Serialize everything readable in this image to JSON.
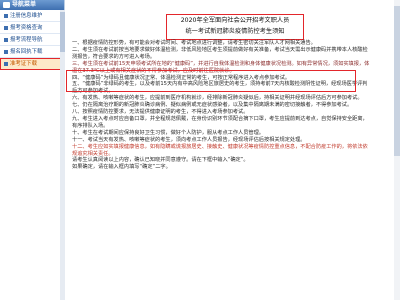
{
  "sidebar": {
    "title": "导航菜单",
    "items": [
      {
        "label": "注册信息维护"
      },
      {
        "label": "报考资格查询"
      },
      {
        "label": "报考流程导航"
      },
      {
        "label": "报名回执下载"
      },
      {
        "label": "准考证下载"
      }
    ]
  },
  "doc": {
    "title_line1": "2020年全军面向社会公开招考文职人员",
    "title_line2": "统一考试新冠肺炎疫情防控考生须知",
    "paragraphs": [
      "一、根据疫情防控形势，有可能会对考试时间、考试地点进行调整，请考生密切关注军队人才网相关通告。",
      "二、考生须在考试前按当地要求做好体温检测，非低风险地区考生须提前做好有关准备，考试当天需出示健康码并携带本人核酸检测报告，符合要求的方可进入考场。",
      "三、考生须在考试前15天申领考试所在地的“健康码”，并进行自我体温检测和身体健康状况检测。如有异常情况，须如实填报，体温在37.3℃以上或有相关症状的不得参加考试，应及时前往医院就诊。",
      "四、“健康码”为绿码且健康状况正常、体温检测正常的考生，可按正常程序进入考点参加考试。",
      "五、“健康码”非绿码的考生，以及考前15天内有中高风险地区旅居史的考生，须持考前7天内核酸检测阴性证明，经现场医学评判后方可参加考试。",
      "六、有发热、咳嗽等症状的考生，应提前到医疗机构就诊，经排除新冠肺炎疑似后，持相关证明并经现场评估后方可参加考试。",
      "七、仍在隔离治疗期的新冠肺炎确诊病例、疑似病例或无症状感染者，以及集中隔离期未满的密切接触者，不得参加考试。",
      "八、按照疫情防控要求，无法提供健康证明的考生，不得进入考场参加考试。",
      "九、考生进入考点时应自备口罩，并全程规范佩戴，在身份识别环节须配合摘下口罩，考生应提前到达考点，自觉保持安全距离，有序排队入场。",
      "十、考生在考试期间应保持良好卫生习惯，做好个人防护，服从考点工作人员管理。",
      "十一、考试当天有发热、咳嗽等症状的考生，须向考点工作人员报告，经现场评估后按相关规定处理。",
      "十二、考生应如实填报健康信息，如有隐瞒或谎报旅居史、接触史、健康状况等疫情防控重点信息，不配合防疫工作的，将依法依规追究相关责任。",
      "请考生认真阅读以上内容，确认已知晓并同意遵守。请在下框中输入“确定”。",
      "如果确定，请在输入框内填写“确定”二字。"
    ]
  },
  "colors": {
    "annotation": "#e3262b",
    "nav_accent": "#3e6fb0",
    "active_bg": "#fde9c9"
  }
}
